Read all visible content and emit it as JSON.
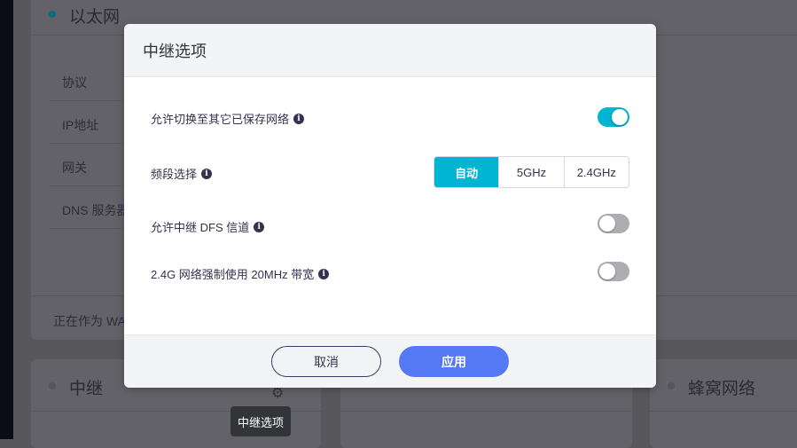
{
  "background": {
    "ethernet": {
      "title": "以太网",
      "rows": [
        "协议",
        "IP地址",
        "网关",
        "DNS 服务器"
      ],
      "footer": "正在作为 WA"
    },
    "repeater": {
      "title": "中继"
    },
    "cellular": {
      "title": "蜂窝网络"
    },
    "tooltip": "中继选项"
  },
  "modal": {
    "title": "中继选项",
    "options": [
      {
        "label": "允许切换至其它已保存网络",
        "enabled": true
      },
      {
        "label": "频段选择"
      },
      {
        "label": "允许中继 DFS 信道",
        "enabled": false
      },
      {
        "label": "2.4G 网络强制使用 20MHz 带宽",
        "enabled": false
      }
    ],
    "band": {
      "options": [
        "自动",
        "5GHz",
        "2.4GHz"
      ],
      "selected": "自动"
    },
    "cancel": "取消",
    "apply": "应用"
  },
  "colors": {
    "accent": "#00b4d2",
    "primary": "#5578f5"
  }
}
